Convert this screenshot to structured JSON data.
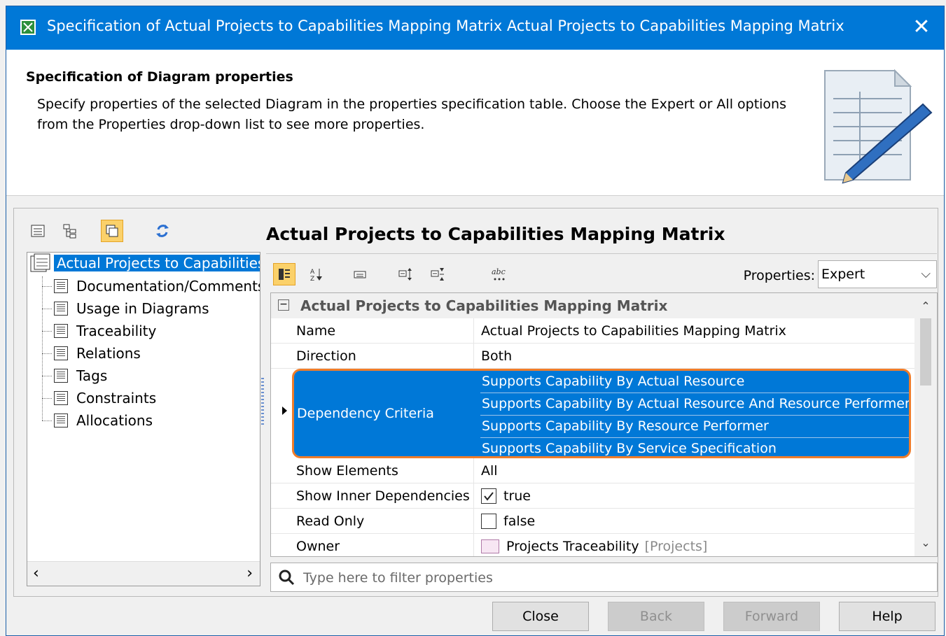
{
  "window": {
    "title": "Specification of Actual Projects to Capabilities Mapping Matrix Actual Projects to Capabilities Mapping Matrix",
    "close_glyph": "✕"
  },
  "header": {
    "title": "Specification of Diagram properties",
    "description": "Specify properties of the selected Diagram in the properties specification table. Choose the Expert or All options from the Properties drop-down list to see more properties."
  },
  "tree": {
    "root": "Actual Projects to Capabilities",
    "items": [
      "Documentation/Comments",
      "Usage in Diagrams",
      "Traceability",
      "Relations",
      "Tags",
      "Constraints",
      "Allocations"
    ]
  },
  "spec": {
    "title": "Actual Projects to Capabilities Mapping Matrix",
    "properties_label": "Properties:",
    "properties_value": "Expert",
    "group_title": "Actual Projects to Capabilities Mapping Matrix",
    "rows": {
      "name": {
        "label": "Name",
        "value": "Actual Projects to Capabilities Mapping Matrix"
      },
      "direction": {
        "label": "Direction",
        "value": "Both"
      },
      "dependency_criteria": {
        "label": "Dependency Criteria",
        "values": [
          "Supports Capability By Actual Resource",
          "Supports Capability By Actual Resource And Resource Performer",
          "Supports Capability By Resource Performer",
          "Supports Capability By Service Specification"
        ]
      },
      "show_elements": {
        "label": "Show Elements",
        "value": "All"
      },
      "show_inner": {
        "label": "Show Inner Dependencies",
        "value": "true",
        "checked": true
      },
      "read_only": {
        "label": "Read Only",
        "value": "false",
        "checked": false
      },
      "owner": {
        "label": "Owner",
        "value": "Projects Traceability",
        "scope": "[Projects]"
      }
    },
    "filter_placeholder": "Type here to filter properties"
  },
  "buttons": {
    "close": "Close",
    "back": "Back",
    "forward": "Forward",
    "help": "Help"
  },
  "colors": {
    "accent": "#0078d7",
    "highlight_outline": "#f07d2a",
    "active_tool": "#fbd16a"
  }
}
